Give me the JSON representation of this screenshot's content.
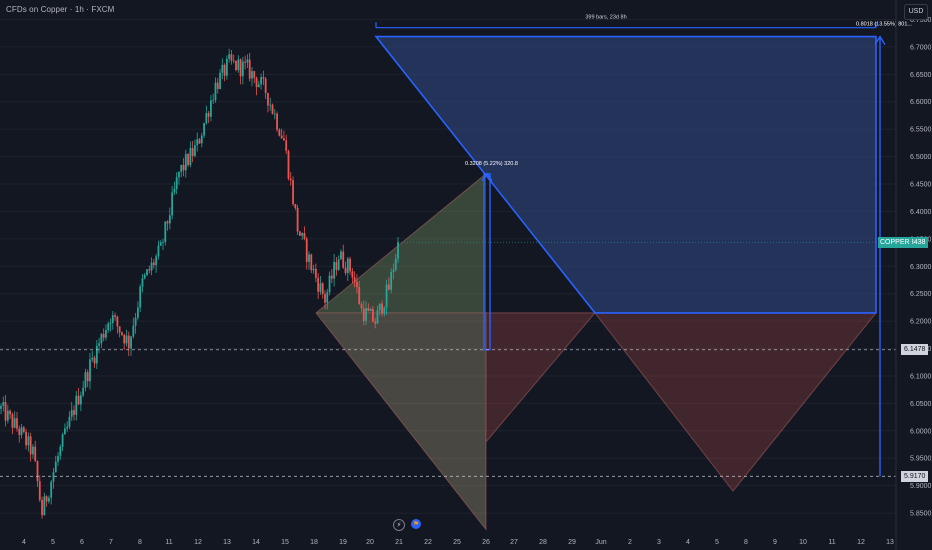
{
  "header": {
    "title": "CFDs on Copper · 1h · FXCM",
    "currency": "USD"
  },
  "colors": {
    "background": "#131722",
    "grid": "#1e222d",
    "up": "#26a69a",
    "down": "#ef5350",
    "projection_line": "#2962ff",
    "projection_fill": "#2a3e6e",
    "dashed_line": "#d1d4dc"
  },
  "chart_data": {
    "type": "candlestick",
    "symbol": "COPPER",
    "interval": "1h",
    "ylim": [
      5.81,
      6.76
    ],
    "y_ticks": [
      "6.7500",
      "6.7000",
      "6.6500",
      "6.6000",
      "6.5500",
      "6.5000",
      "6.4500",
      "6.4000",
      "6.3500",
      "6.3000",
      "6.2500",
      "6.2000",
      "6.1500",
      "6.1000",
      "6.0500",
      "6.0000",
      "5.9500",
      "5.9000",
      "5.8500"
    ],
    "x_ticks": [
      "4",
      "5",
      "6",
      "7",
      "8",
      "11",
      "12",
      "13",
      "14",
      "15",
      "18",
      "19",
      "20",
      "21",
      "22",
      "25",
      "26",
      "27",
      "28",
      "29",
      "Jun",
      "2",
      "3",
      "4",
      "5",
      "8",
      "9",
      "10",
      "11",
      "12",
      "13"
    ],
    "anchors": [
      {
        "bar": 0,
        "close": 6.04
      },
      {
        "bar": 8,
        "close": 6.0
      },
      {
        "bar": 14,
        "close": 5.96
      },
      {
        "bar": 18,
        "close": 5.85
      },
      {
        "bar": 24,
        "close": 5.94
      },
      {
        "bar": 32,
        "close": 6.04
      },
      {
        "bar": 40,
        "close": 6.13
      },
      {
        "bar": 48,
        "close": 6.21
      },
      {
        "bar": 56,
        "close": 6.16
      },
      {
        "bar": 62,
        "close": 6.27
      },
      {
        "bar": 70,
        "close": 6.33
      },
      {
        "bar": 78,
        "close": 6.47
      },
      {
        "bar": 86,
        "close": 6.52
      },
      {
        "bar": 94,
        "close": 6.63
      },
      {
        "bar": 100,
        "close": 6.67
      },
      {
        "bar": 108,
        "close": 6.66
      },
      {
        "bar": 116,
        "close": 6.62
      },
      {
        "bar": 124,
        "close": 6.53
      },
      {
        "bar": 130,
        "close": 6.37
      },
      {
        "bar": 136,
        "close": 6.3
      },
      {
        "bar": 142,
        "close": 6.24
      },
      {
        "bar": 148,
        "close": 6.32
      },
      {
        "bar": 154,
        "close": 6.29
      },
      {
        "bar": 158,
        "close": 6.22
      },
      {
        "bar": 164,
        "close": 6.2
      },
      {
        "bar": 170,
        "close": 6.26
      },
      {
        "bar": 174,
        "close": 6.34
      }
    ],
    "horizontal_lines": [
      {
        "price": 6.1478,
        "label": "6.1478",
        "color": "#d1d4dc"
      },
      {
        "price": 5.917,
        "label": "5.9170",
        "color": "#d1d4dc"
      }
    ],
    "last_price": {
      "price": 6.3438,
      "label": "6.3438",
      "symbol_label": "COPPER",
      "color": "#26a69a"
    },
    "measurements": [
      {
        "label": "0.3208 (5.22%) 320.8",
        "target_price": 6.4686,
        "base_price": 6.1478
      },
      {
        "label": "0.8018 (13.55%) 801...",
        "target_price": 6.7188,
        "base_price": 5.917
      },
      {
        "label": "399 bars, 23d 8h"
      }
    ],
    "grid": false,
    "legend": "none"
  },
  "bottom_icons": [
    {
      "name": "lightning-icon",
      "glyph": "⚡"
    },
    {
      "name": "flag-icon",
      "glyph": "⚑"
    }
  ]
}
